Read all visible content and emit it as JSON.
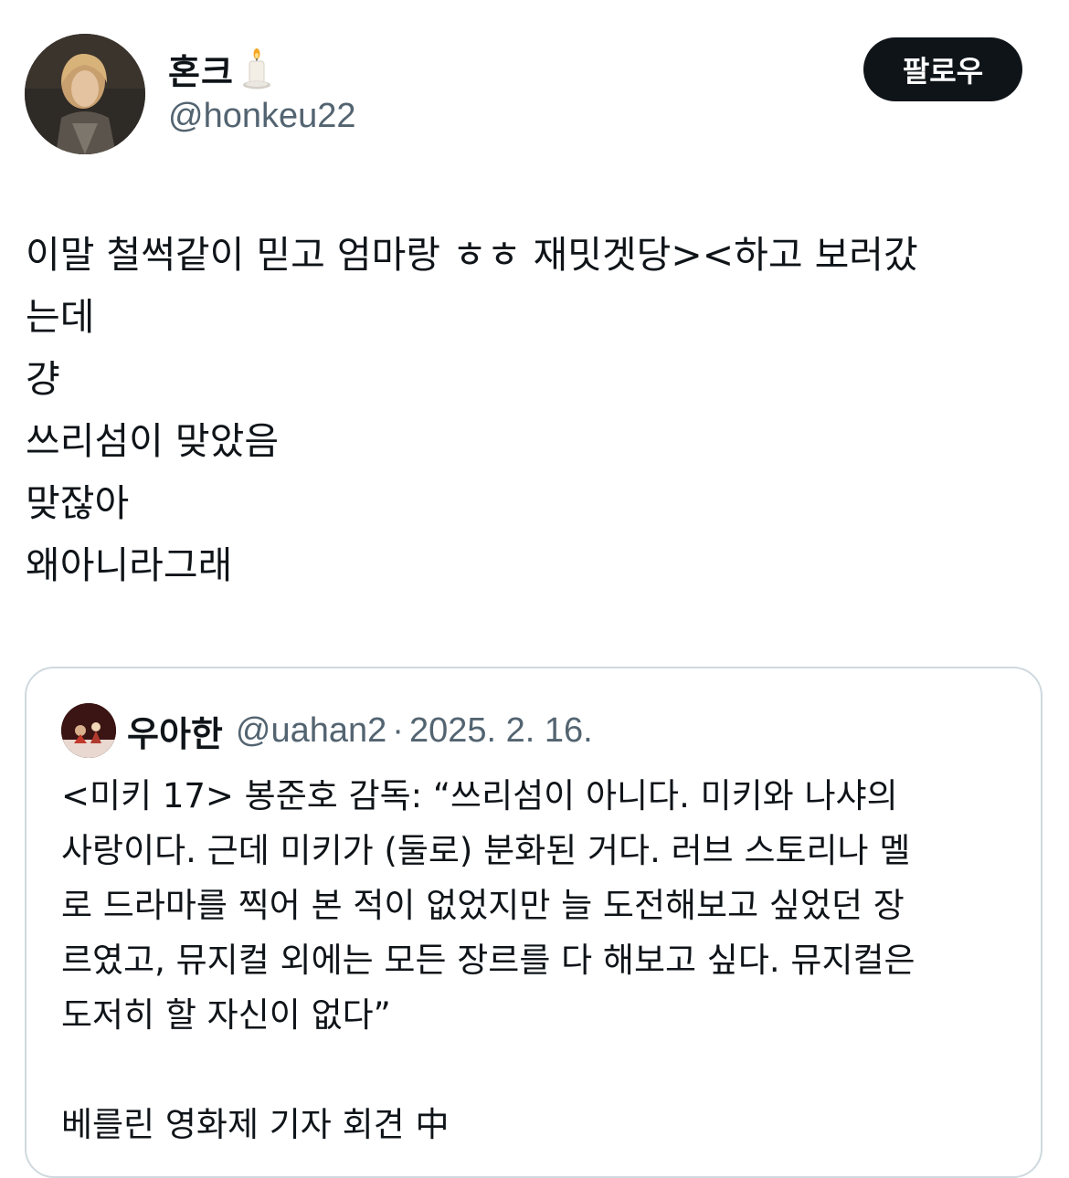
{
  "author": {
    "display_name": "혼크",
    "name_emoji_icon": "candle-icon",
    "handle": "@honkeu22",
    "avatar": "profile-photo"
  },
  "follow_label": "팔로우",
  "tweet_lines": [
    "이말 철썩같이 믿고 엄마랑 ㅎㅎ 재밋겟당><하고 보러갔",
    "는데",
    "걍",
    "쓰리섬이 맞았음",
    "맞잖아",
    "왜아니라그래"
  ],
  "quote": {
    "display_name": "우아한",
    "handle": "@uahan2",
    "separator": "·",
    "date": "2025. 2. 16.",
    "lines": [
      "<미키 17> 봉준호 감독: “쓰리섬이 아니다. 미키와 나샤의",
      "사랑이다. 근데 미키가 (둘로) 분화된 거다. 러브 스토리나 멜",
      "로 드라마를 찍어 본 적이 없었지만 늘 도전해보고 싶었던 장",
      "르였고, 뮤지컬 외에는 모든 장르를 다 해보고 싶다. 뮤지컬은",
      "도저히 할 자신이 없다”",
      "",
      "베를린 영화제 기자 회견 中"
    ]
  },
  "colors": {
    "text": "#0f1419",
    "secondary": "#536471",
    "border": "#cfd9de",
    "button_bg": "#0f1419",
    "button_text": "#ffffff"
  }
}
